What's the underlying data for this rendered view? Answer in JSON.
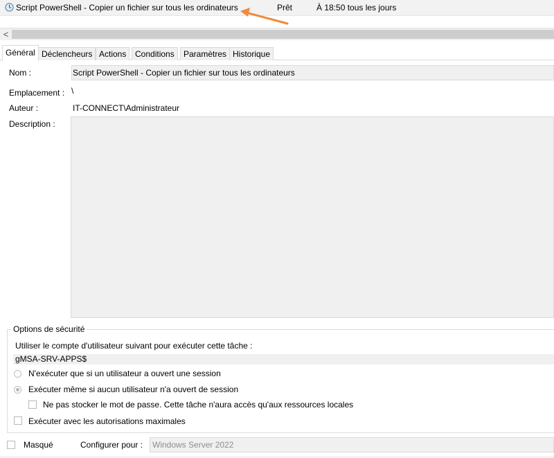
{
  "task_row": {
    "name": "Script PowerShell - Copier un fichier sur tous les ordinateurs",
    "status": "Prêt",
    "trigger": "À 18:50 tous les jours"
  },
  "colors": {
    "arrow": "#f08a3c",
    "readonly_bg": "#f0f0f0"
  },
  "scrollbar": {
    "left_arrow": "<"
  },
  "tabs": [
    {
      "label": "Général"
    },
    {
      "label": "Déclencheurs"
    },
    {
      "label": "Actions"
    },
    {
      "label": "Conditions"
    },
    {
      "label": "Paramètres"
    },
    {
      "label": "Historique"
    }
  ],
  "general": {
    "name_label": "Nom :",
    "name_value": "Script PowerShell - Copier un fichier sur tous les ordinateurs",
    "location_label": "Emplacement :",
    "location_value": "\\",
    "author_label": "Auteur :",
    "author_value": "IT-CONNECT\\Administrateur",
    "description_label": "Description :",
    "description_value": ""
  },
  "security": {
    "title": "Options de sécurité",
    "account_prompt": "Utiliser le compte d'utilisateur suivant pour exécuter cette tâche :",
    "account_value": "gMSA-SRV-APPS$",
    "radio_logged_on": "N'exécuter que si un utilisateur a ouvert une session",
    "radio_whether_logged": "Exécuter même si aucun utilisateur n'a ouvert de session",
    "selected_radio": "whether_logged",
    "no_store_password": "Ne pas stocker le mot de passe. Cette tâche n'aura accès qu'aux ressources locales",
    "highest_privileges": "Exécuter avec les autorisations maximales"
  },
  "footer": {
    "hidden_label": "Masqué",
    "configure_label": "Configurer pour :",
    "configure_value": "Windows Server 2022"
  }
}
